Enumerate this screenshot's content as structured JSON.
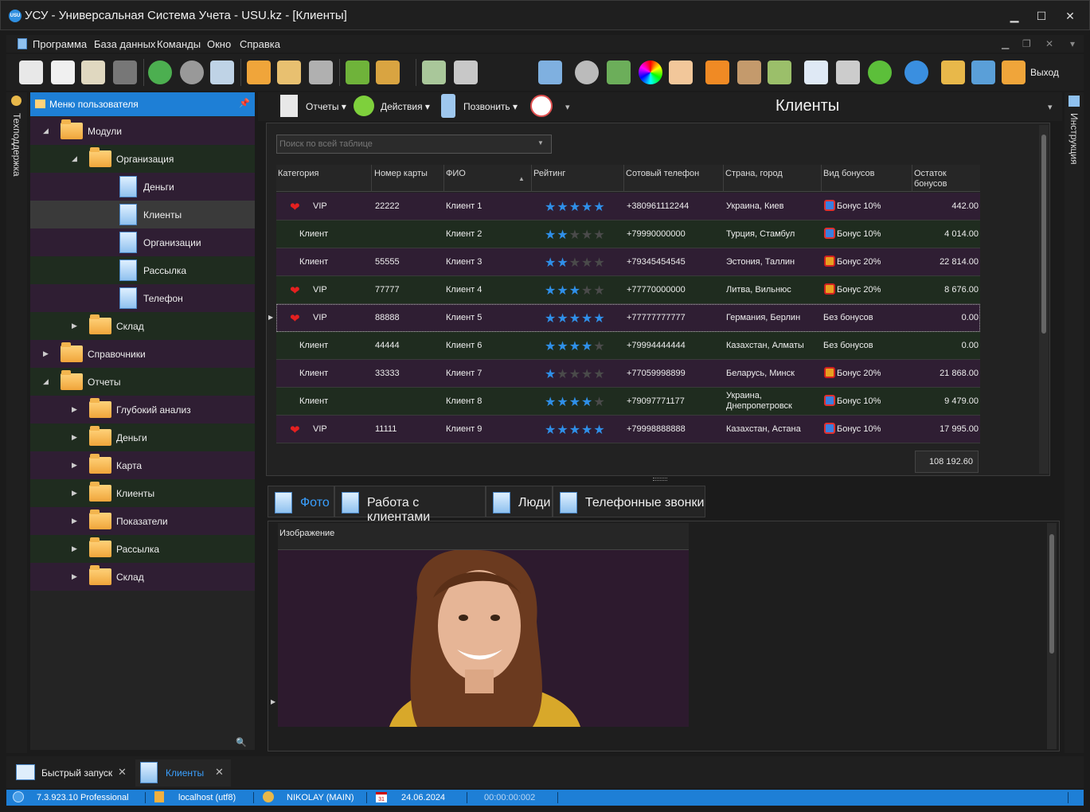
{
  "window": {
    "title": "УСУ - Универсальная Система Учета - USU.kz - [Клиенты]",
    "app_icon": "USU",
    "minimize": "▁",
    "maximize": "☐",
    "close": "✕"
  },
  "menu": [
    "Программа",
    "База данных",
    "Команды",
    "Окно",
    "Справка"
  ],
  "toolbar": {
    "exit_label": "Выход"
  },
  "side_strips": {
    "left": "Техподдержка",
    "right": "Инструкция"
  },
  "nav": {
    "header": "Меню пользователя",
    "items": [
      {
        "label": "Модули",
        "type": "folder",
        "level": 0
      },
      {
        "label": "Организация",
        "type": "folder",
        "level": 1
      },
      {
        "label": "Деньги",
        "type": "doc",
        "level": 2
      },
      {
        "label": "Клиенты",
        "type": "doc",
        "level": 2
      },
      {
        "label": "Организации",
        "type": "doc",
        "level": 2
      },
      {
        "label": "Рассылка",
        "type": "doc",
        "level": 2
      },
      {
        "label": "Телефон",
        "type": "doc",
        "level": 2
      },
      {
        "label": "Склад",
        "type": "folder",
        "level": 1
      },
      {
        "label": "Справочники",
        "type": "folder",
        "level": 0
      },
      {
        "label": "Отчеты",
        "type": "folder",
        "level": 0
      },
      {
        "label": "Глубокий анализ",
        "type": "folder",
        "level": 1
      },
      {
        "label": "Деньги",
        "type": "folder",
        "level": 1
      },
      {
        "label": "Карта",
        "type": "folder",
        "level": 1
      },
      {
        "label": "Клиенты",
        "type": "folder",
        "level": 1
      },
      {
        "label": "Показатели",
        "type": "folder",
        "level": 1
      },
      {
        "label": "Рассылка",
        "type": "folder",
        "level": 1
      },
      {
        "label": "Склад",
        "type": "folder",
        "level": 1
      }
    ]
  },
  "subtoolbar": {
    "reports": "Отчеты",
    "actions": "Действия",
    "call": "Позвонить",
    "title": "Клиенты"
  },
  "grid": {
    "search_placeholder": "Поиск по всей таблице",
    "columns": [
      "Категория",
      "Номер карты",
      "ФИО",
      "Рейтинг",
      "Сотовый телефон",
      "Страна, город",
      "Вид бонусов",
      "Остаток бонусов"
    ],
    "rows": [
      {
        "vip": true,
        "category": "VIP",
        "card": "22222",
        "name": "Клиент 1",
        "rating": 5,
        "phone": "+380961112244",
        "city": "Украина, Киев",
        "bonus": "Бонус 10%",
        "bonus_icon": "blue",
        "rest": "442.00"
      },
      {
        "vip": false,
        "category": "Клиент",
        "card": "",
        "name": "Клиент 2",
        "rating": 2,
        "phone": "+79990000000",
        "city": "Турция, Стамбул",
        "bonus": "Бонус 10%",
        "bonus_icon": "blue",
        "rest": "4 014.00"
      },
      {
        "vip": false,
        "category": "Клиент",
        "card": "55555",
        "name": "Клиент 3",
        "rating": 2,
        "phone": "+79345454545",
        "city": "Эстония, Таллин",
        "bonus": "Бонус 20%",
        "bonus_icon": "red",
        "rest": "22 814.00"
      },
      {
        "vip": true,
        "category": "VIP",
        "card": "77777",
        "name": "Клиент 4",
        "rating": 3,
        "phone": "+77770000000",
        "city": "Литва, Вильнюс",
        "bonus": "Бонус 20%",
        "bonus_icon": "red",
        "rest": "8 676.00"
      },
      {
        "vip": true,
        "category": "VIP",
        "card": "88888",
        "name": "Клиент 5",
        "rating": 5,
        "phone": "+77777777777",
        "city": "Германия, Берлин",
        "bonus": "Без бонусов",
        "bonus_icon": "",
        "rest": "0.00"
      },
      {
        "vip": false,
        "category": "Клиент",
        "card": "44444",
        "name": "Клиент 6",
        "rating": 4,
        "phone": "+79994444444",
        "city": "Казахстан, Алматы",
        "bonus": "Без бонусов",
        "bonus_icon": "",
        "rest": "0.00"
      },
      {
        "vip": false,
        "category": "Клиент",
        "card": "33333",
        "name": "Клиент 7",
        "rating": 1,
        "phone": "+77059998899",
        "city": "Беларусь, Минск",
        "bonus": "Бонус 20%",
        "bonus_icon": "red",
        "rest": "21 868.00"
      },
      {
        "vip": false,
        "category": "Клиент",
        "card": "",
        "name": "Клиент 8",
        "rating": 4,
        "phone": "+79097771177",
        "city": "Украина,\nДнепропетровск",
        "bonus": "Бонус 10%",
        "bonus_icon": "blue",
        "rest": "9 479.00"
      },
      {
        "vip": true,
        "category": "VIP",
        "card": "11111",
        "name": "Клиент 9",
        "rating": 5,
        "phone": "+79998888888",
        "city": "Казахстан, Астана",
        "bonus": "Бонус 10%",
        "bonus_icon": "blue",
        "rest": "17 995.00"
      }
    ],
    "total": "108 192.60"
  },
  "detail_tabs": [
    "Фото",
    "Работа с клиентами",
    "Люди",
    "Телефонные звонки"
  ],
  "photo": {
    "column_header": "Изображение"
  },
  "bottom_tabs": [
    {
      "label": "Быстрый запуск",
      "active": false
    },
    {
      "label": "Клиенты",
      "active": true
    }
  ],
  "status": {
    "version": "7.3.923.10 Professional",
    "db": "localhost (utf8)",
    "user": "NIKOLAY (MAIN)",
    "calendar_day": "31",
    "date": "24.06.2024",
    "timer": "00:00:00:002"
  },
  "colors": {
    "accent": "#1e7fd6",
    "row_odd": "#2f1e33",
    "row_even": "#1f2c1f",
    "star_on": "#2f8fe8",
    "star_off": "#4a4a4a",
    "heart": "#e52020"
  }
}
